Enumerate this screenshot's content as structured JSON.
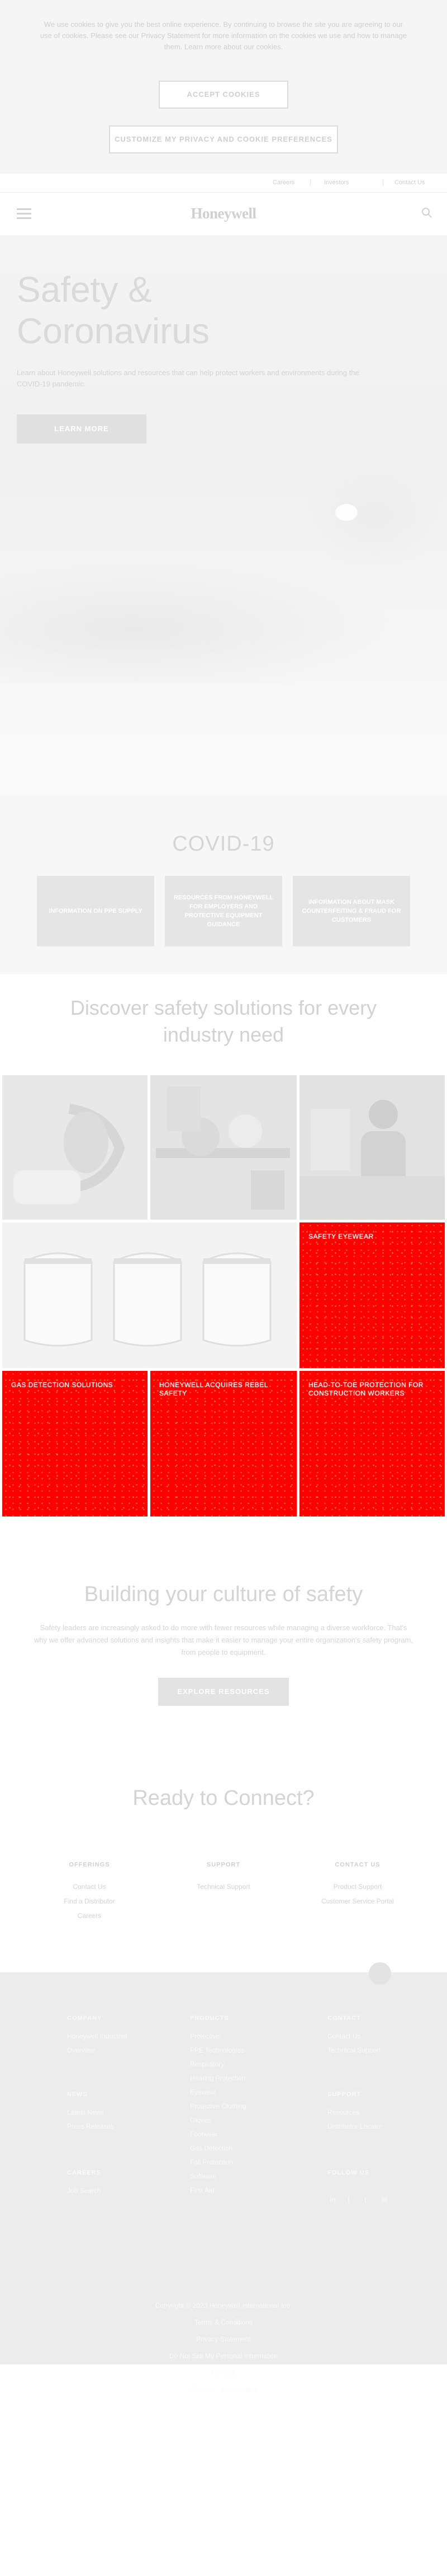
{
  "cookie": {
    "text": "We use cookies to give you the best online experience. By continuing to browse the site you are agreeing to our use of cookies. Please see our Privacy Statement for more information on the cookies we use and how to manage them. Learn more about our cookies.",
    "accept": "ACCEPT COOKIES",
    "customize": "CUSTOMIZE MY PRIVACY AND COOKIE PREFERENCES"
  },
  "util": [
    "Careers",
    "Investors",
    "Contact Us"
  ],
  "header": {
    "logo": "Honeywell"
  },
  "hero": {
    "title": "Safety & Coronavirus",
    "body": "Learn about Honeywell solutions and resources that can help protect workers and environments during the COVID-19 pandemic.",
    "cta": "LEARN MORE"
  },
  "covid": {
    "title": "COVID-19",
    "boxes": [
      "INFORMATION ON PPE SUPPLY",
      "RESOURCES FROM HONEYWELL FOR EMPLOYERS AND PROTECTIVE EQUIPMENT GUIDANCE",
      "INFORMATION ABOUT MASK COUNTERFEITING & FRAUD FOR CUSTOMERS"
    ]
  },
  "discover": {
    "title": "Discover safety solutions for every industry need",
    "tiles": [
      "SAFETY EYEWEAR",
      "GAS DETECTION SOLUTIONS",
      "HONEYWELL ACQUIRES REBEL SAFETY",
      "HEAD-TO-TOE PROTECTION FOR CONSTRUCTION WORKERS"
    ]
  },
  "culture": {
    "title": "Building your culture of safety",
    "body": "Safety leaders are increasingly asked to do more with fewer resources while managing a diverse workforce. That's why we offer advanced solutions and insights that make it easier to manage your entire organization's safety program, from people to equipment.",
    "cta": "EXPLORE RESOURCES"
  },
  "ready": {
    "title": "Ready to Connect?",
    "cols": [
      {
        "head": "OFFERINGS",
        "links": [
          "Contact Us",
          "Find a Distributor",
          "Careers"
        ]
      },
      {
        "head": "SUPPORT",
        "links": [
          "Technical Support"
        ]
      },
      {
        "head": "CONTACT US",
        "links": [
          "Product Support",
          "Customer Service Portal"
        ]
      }
    ]
  },
  "footer": {
    "columns": [
      {
        "head": "COMPANY",
        "links": [
          "Honeywell Industrial",
          "Overview"
        ]
      },
      {
        "head": "NEWS",
        "links": [
          "Latest News",
          "Press Releases"
        ]
      },
      {
        "head": "CAREERS",
        "links": [
          "Job Search"
        ]
      },
      {
        "head": "PRODUCTS",
        "links": [
          "Protective",
          "PPE Technologies",
          "Respiratory",
          "Hearing Protection",
          "Eyewear",
          "Protective Clothing",
          "Gloves",
          "Footwear",
          "Gas Detection",
          "Fall Protection",
          "Software",
          "First Aid"
        ]
      },
      {
        "head": "CONTACT",
        "links": [
          "Contact Us",
          "Technical Support"
        ]
      },
      {
        "head": "SUPPORT",
        "links": [
          "Resources",
          "Distributor Locator"
        ]
      },
      {
        "head": "FOLLOW US",
        "links": []
      }
    ],
    "social": [
      "in",
      "f",
      "t",
      "✉"
    ],
    "bottom": [
      "Copyright © 2023 Honeywell International Inc.",
      "Terms & Conditions",
      "Privacy Statement",
      "Do Not Sell My Personal Information",
      "Cookies",
      "Sitemap · Accessibility"
    ]
  }
}
